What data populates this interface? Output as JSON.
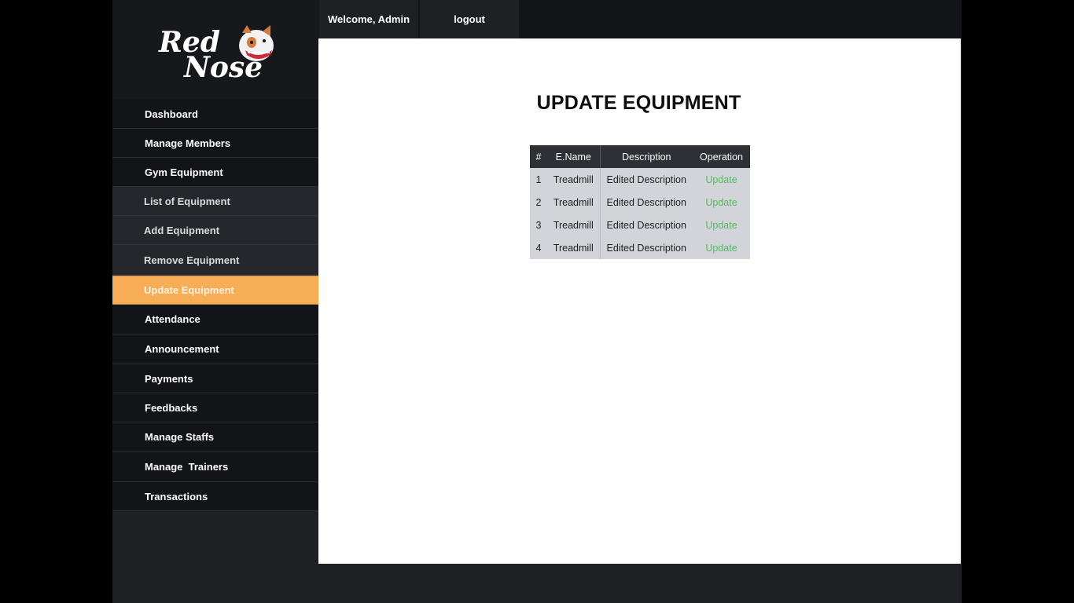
{
  "logo": {
    "text_line1": "Red",
    "text_line2": "Nose",
    "mascot": "bulldog-mascot-icon"
  },
  "header": {
    "welcome_text": "Welcome, Admin",
    "logout_label": "logout"
  },
  "sidebar": {
    "items": [
      {
        "label": "Dashboard"
      },
      {
        "label": "Manage Members"
      },
      {
        "label": "Gym Equipment"
      },
      {
        "label": "List of Equipment"
      },
      {
        "label": "Add Equipment"
      },
      {
        "label": "Remove Equipment"
      },
      {
        "label": "Update Equipment"
      },
      {
        "label": "Attendance"
      },
      {
        "label": "Announcement"
      },
      {
        "label": "Payments"
      },
      {
        "label": "Feedbacks"
      },
      {
        "label": "Manage Staffs"
      },
      {
        "label": "Manage  Trainers"
      },
      {
        "label": "Transactions"
      }
    ],
    "active_item": "Update Equipment"
  },
  "main": {
    "title": "UPDATE EQUIPMENT",
    "table": {
      "headers": [
        "#",
        "E.Name",
        "Description",
        "Operation"
      ],
      "rows": [
        {
          "index": "1",
          "name": "Treadmill",
          "description": "Edited Description",
          "operation": "Update"
        },
        {
          "index": "2",
          "name": "Treadmill",
          "description": "Edited Description",
          "operation": "Update"
        },
        {
          "index": "3",
          "name": "Treadmill",
          "description": "Edited Description",
          "operation": "Update"
        },
        {
          "index": "4",
          "name": "Treadmill",
          "description": "Edited Description",
          "operation": "Update"
        }
      ]
    }
  },
  "colors": {
    "accent": "#f7ad55",
    "sidebar_bg": "#131418",
    "submenu_bg": "#25272c",
    "table_header_bg": "#2e3035",
    "table_row_bg": "#d2d4d9",
    "link_green": "#58b863"
  }
}
